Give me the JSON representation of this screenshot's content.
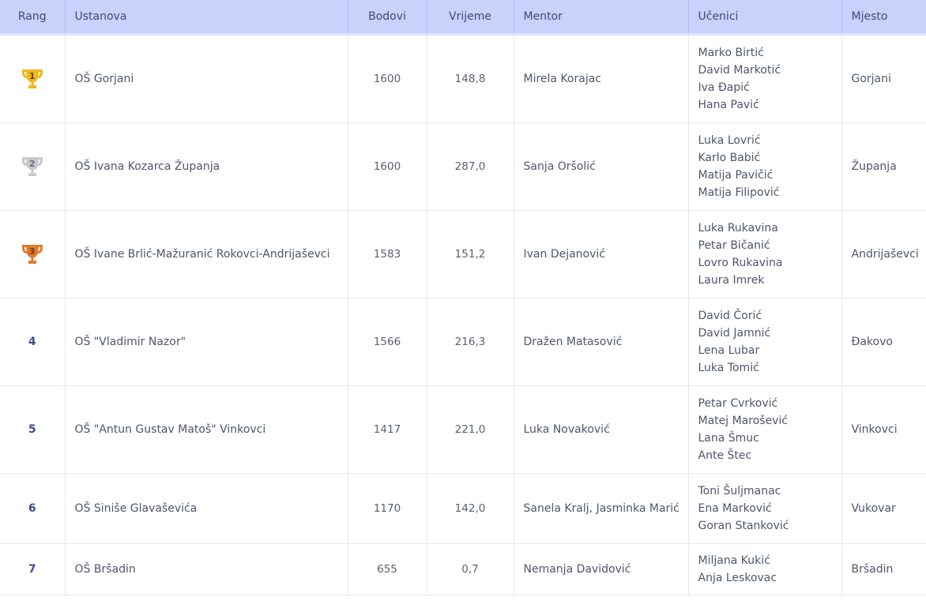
{
  "headers": {
    "rang": "Rang",
    "ustanova": "Ustanova",
    "bodovi": "Bodovi",
    "vrijeme": "Vrijeme",
    "mentor": "Mentor",
    "ucenici": "Učenici",
    "mjesto": "Mjesto"
  },
  "colors": {
    "header_bg": "#c9d2fb",
    "gold": "#f2b51c",
    "silver": "#c7c9cf",
    "bronze": "#e27a2e",
    "rank_text": "#3f4d8a"
  },
  "rows": [
    {
      "rank": "1",
      "trophy": "gold-trophy-icon",
      "ustanova": "OŠ Gorjani",
      "bodovi": "1600",
      "vrijeme": "148,8",
      "mentor": "Mirela Korajac",
      "ucenici": [
        "Marko Birtić",
        "David Markotić",
        "Iva Đapić",
        "Hana Pavić"
      ],
      "mjesto": "Gorjani"
    },
    {
      "rank": "2",
      "trophy": "silver-trophy-icon",
      "ustanova": "OŠ Ivana Kozarca Županja",
      "bodovi": "1600",
      "vrijeme": "287,0",
      "mentor": "Sanja Oršolić",
      "ucenici": [
        "Luka Lovrić",
        "Karlo Babić",
        "Matija Pavičić",
        "Matija Filipović"
      ],
      "mjesto": "Županja"
    },
    {
      "rank": "3",
      "trophy": "bronze-trophy-icon",
      "ustanova": "OŠ Ivane Brlić-Mažuranić Rokovci-Andrijaševci",
      "bodovi": "1583",
      "vrijeme": "151,2",
      "mentor": "Ivan Dejanović",
      "ucenici": [
        "Luka Rukavina",
        "Petar Bičanić",
        "Lovro Rukavina",
        "Laura Imrek"
      ],
      "mjesto": "Andrijaševci"
    },
    {
      "rank": "4",
      "ustanova": "OŠ \"Vladimir Nazor\"",
      "bodovi": "1566",
      "vrijeme": "216,3",
      "mentor": "Dražen Matasović",
      "ucenici": [
        "David Čorić",
        "David Jamnić",
        "Lena Lubar",
        "Luka Tomić"
      ],
      "mjesto": "Đakovo"
    },
    {
      "rank": "5",
      "ustanova": "OŠ \"Antun Gustav Matoš\" Vinkovci",
      "bodovi": "1417",
      "vrijeme": "221,0",
      "mentor": "Luka Novaković",
      "ucenici": [
        "Petar Cvrković",
        "Matej Marošević",
        "Lana Šmuc",
        "Ante Štec"
      ],
      "mjesto": "Vinkovci"
    },
    {
      "rank": "6",
      "ustanova": "OŠ Siniše Glavaševića",
      "bodovi": "1170",
      "vrijeme": "142,0",
      "mentor": "Sanela Kralj, Jasminka Marić",
      "ucenici": [
        "Toni Šuljmanac",
        "Ena Marković",
        "Goran Stanković"
      ],
      "mjesto": "Vukovar"
    },
    {
      "rank": "7",
      "ustanova": "OŠ Bršadin",
      "bodovi": "655",
      "vrijeme": "0,7",
      "mentor": "Nemanja Davidović",
      "ucenici": [
        "Miljana Kukić",
        "Anja Leskovac"
      ],
      "mjesto": "Bršadin"
    }
  ]
}
